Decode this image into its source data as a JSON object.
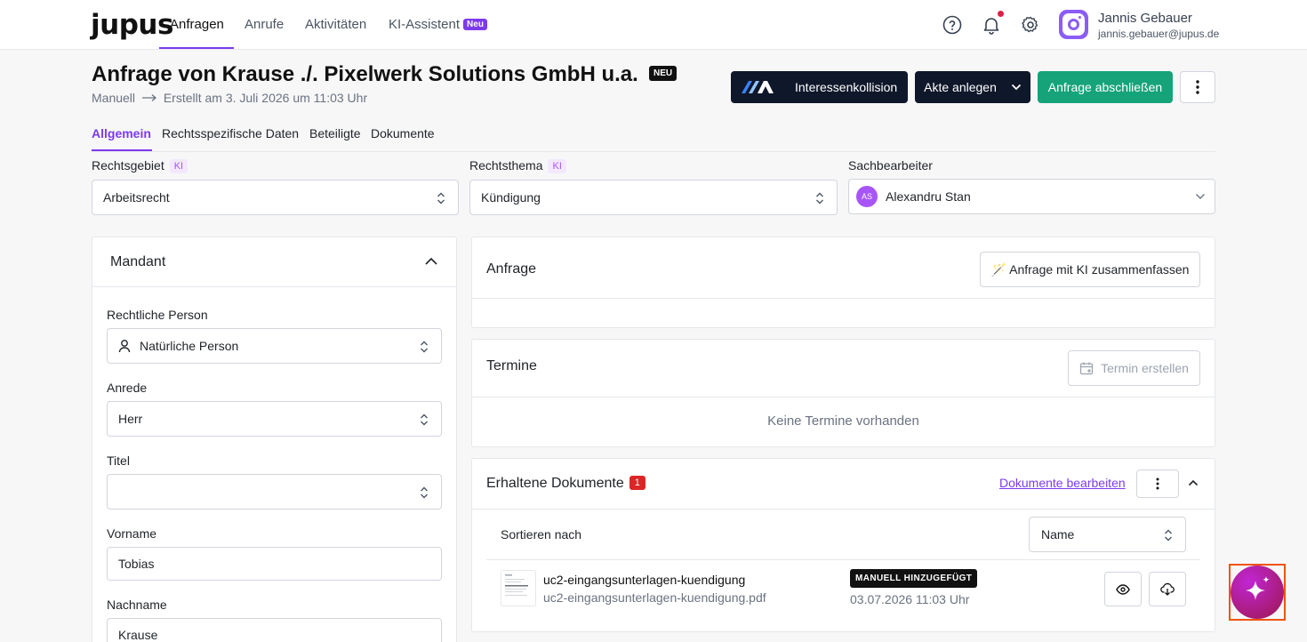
{
  "nav": {
    "logo": "jupus",
    "links": [
      "Anfragen",
      "Anrufe",
      "Aktivitäten",
      "KI-Assistent"
    ],
    "new_badge": "Neu",
    "user_name": "Jannis Gebauer",
    "user_email": "jannis.gebauer@jupus.de"
  },
  "header": {
    "title": "Anfrage von Krause ./. Pixelwerk Solutions GmbH u.a.",
    "title_tag": "NEU",
    "source": "Manuell",
    "created": "Erstellt am 3. Juli 2026 um 11:03 Uhr",
    "btn_collision": "Interessenkollision",
    "btn_create_file": "Akte anlegen",
    "btn_close": "Anfrage abschließen"
  },
  "tabs": [
    "Allgemein",
    "Rechtsspezifische Daten",
    "Beteiligte",
    "Dokumente"
  ],
  "fields": {
    "rechtsgebiet_label": "Rechtsgebiet",
    "rechtsgebiet_value": "Arbeitsrecht",
    "rechtsthema_label": "Rechtsthema",
    "rechtsthema_value": "Kündigung",
    "ki_tag": "KI",
    "sachbearbeiter_label": "Sachbearbeiter",
    "sachbearbeiter_initials": "AS",
    "sachbearbeiter_value": "Alexandru Stan"
  },
  "mandant": {
    "title": "Mandant",
    "rechtliche_person_label": "Rechtliche Person",
    "rechtliche_person_value": "Natürliche Person",
    "anrede_label": "Anrede",
    "anrede_value": "Herr",
    "titel_label": "Titel",
    "titel_value": "",
    "vorname_label": "Vorname",
    "vorname_value": "Tobias",
    "nachname_label": "Nachname",
    "nachname_value": "Krause"
  },
  "anfrage": {
    "title": "Anfrage",
    "summarize_btn": "🪄 Anfrage mit KI zusammenfassen"
  },
  "termine": {
    "title": "Termine",
    "create_btn": "Termin erstellen",
    "empty": "Keine Termine vorhanden"
  },
  "dokumente": {
    "title": "Erhaltene Dokumente",
    "count": "1",
    "edit_link": "Dokumente bearbeiten",
    "sort_label": "Sortieren nach",
    "sort_value": "Name",
    "files": [
      {
        "name": "uc2-eingangsunterlagen-kuendigung",
        "filename": "uc2-eingangsunterlagen-kuendigung.pdf",
        "tag": "MANUELL HINZUGEFÜGT",
        "date": "03.07.2026 11:03 Uhr"
      }
    ]
  },
  "colors": {
    "accent": "#7c3aed",
    "dark": "#0f172a",
    "green": "#16a37a",
    "danger": "#dc2626"
  }
}
